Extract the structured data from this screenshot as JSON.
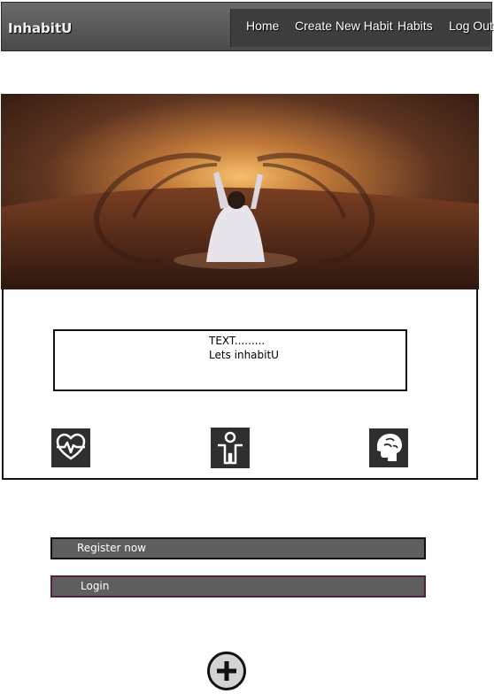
{
  "navbar": {
    "brand": "InhabitU",
    "links": [
      {
        "label": "Home"
      },
      {
        "label": "Create New Habit"
      },
      {
        "label": "Habits"
      },
      {
        "label": "Log Out"
      }
    ]
  },
  "hero": {
    "icon": "desert-photo"
  },
  "card": {
    "text_lines": [
      "TEXT.........",
      "Lets inhabitU"
    ],
    "icons": [
      "heartbeat-icon",
      "person-icon",
      "brain-icon"
    ]
  },
  "actions": {
    "register_label": "Register now",
    "login_label": "Login",
    "add_icon": "plus-icon"
  },
  "colors": {
    "nav_background": "#5a5a5a",
    "nav_panel": "#3d3d3d",
    "button_fill": "#5e5e5e",
    "login_border": "#4e2240",
    "icon_tile": "#2f2f2f"
  }
}
